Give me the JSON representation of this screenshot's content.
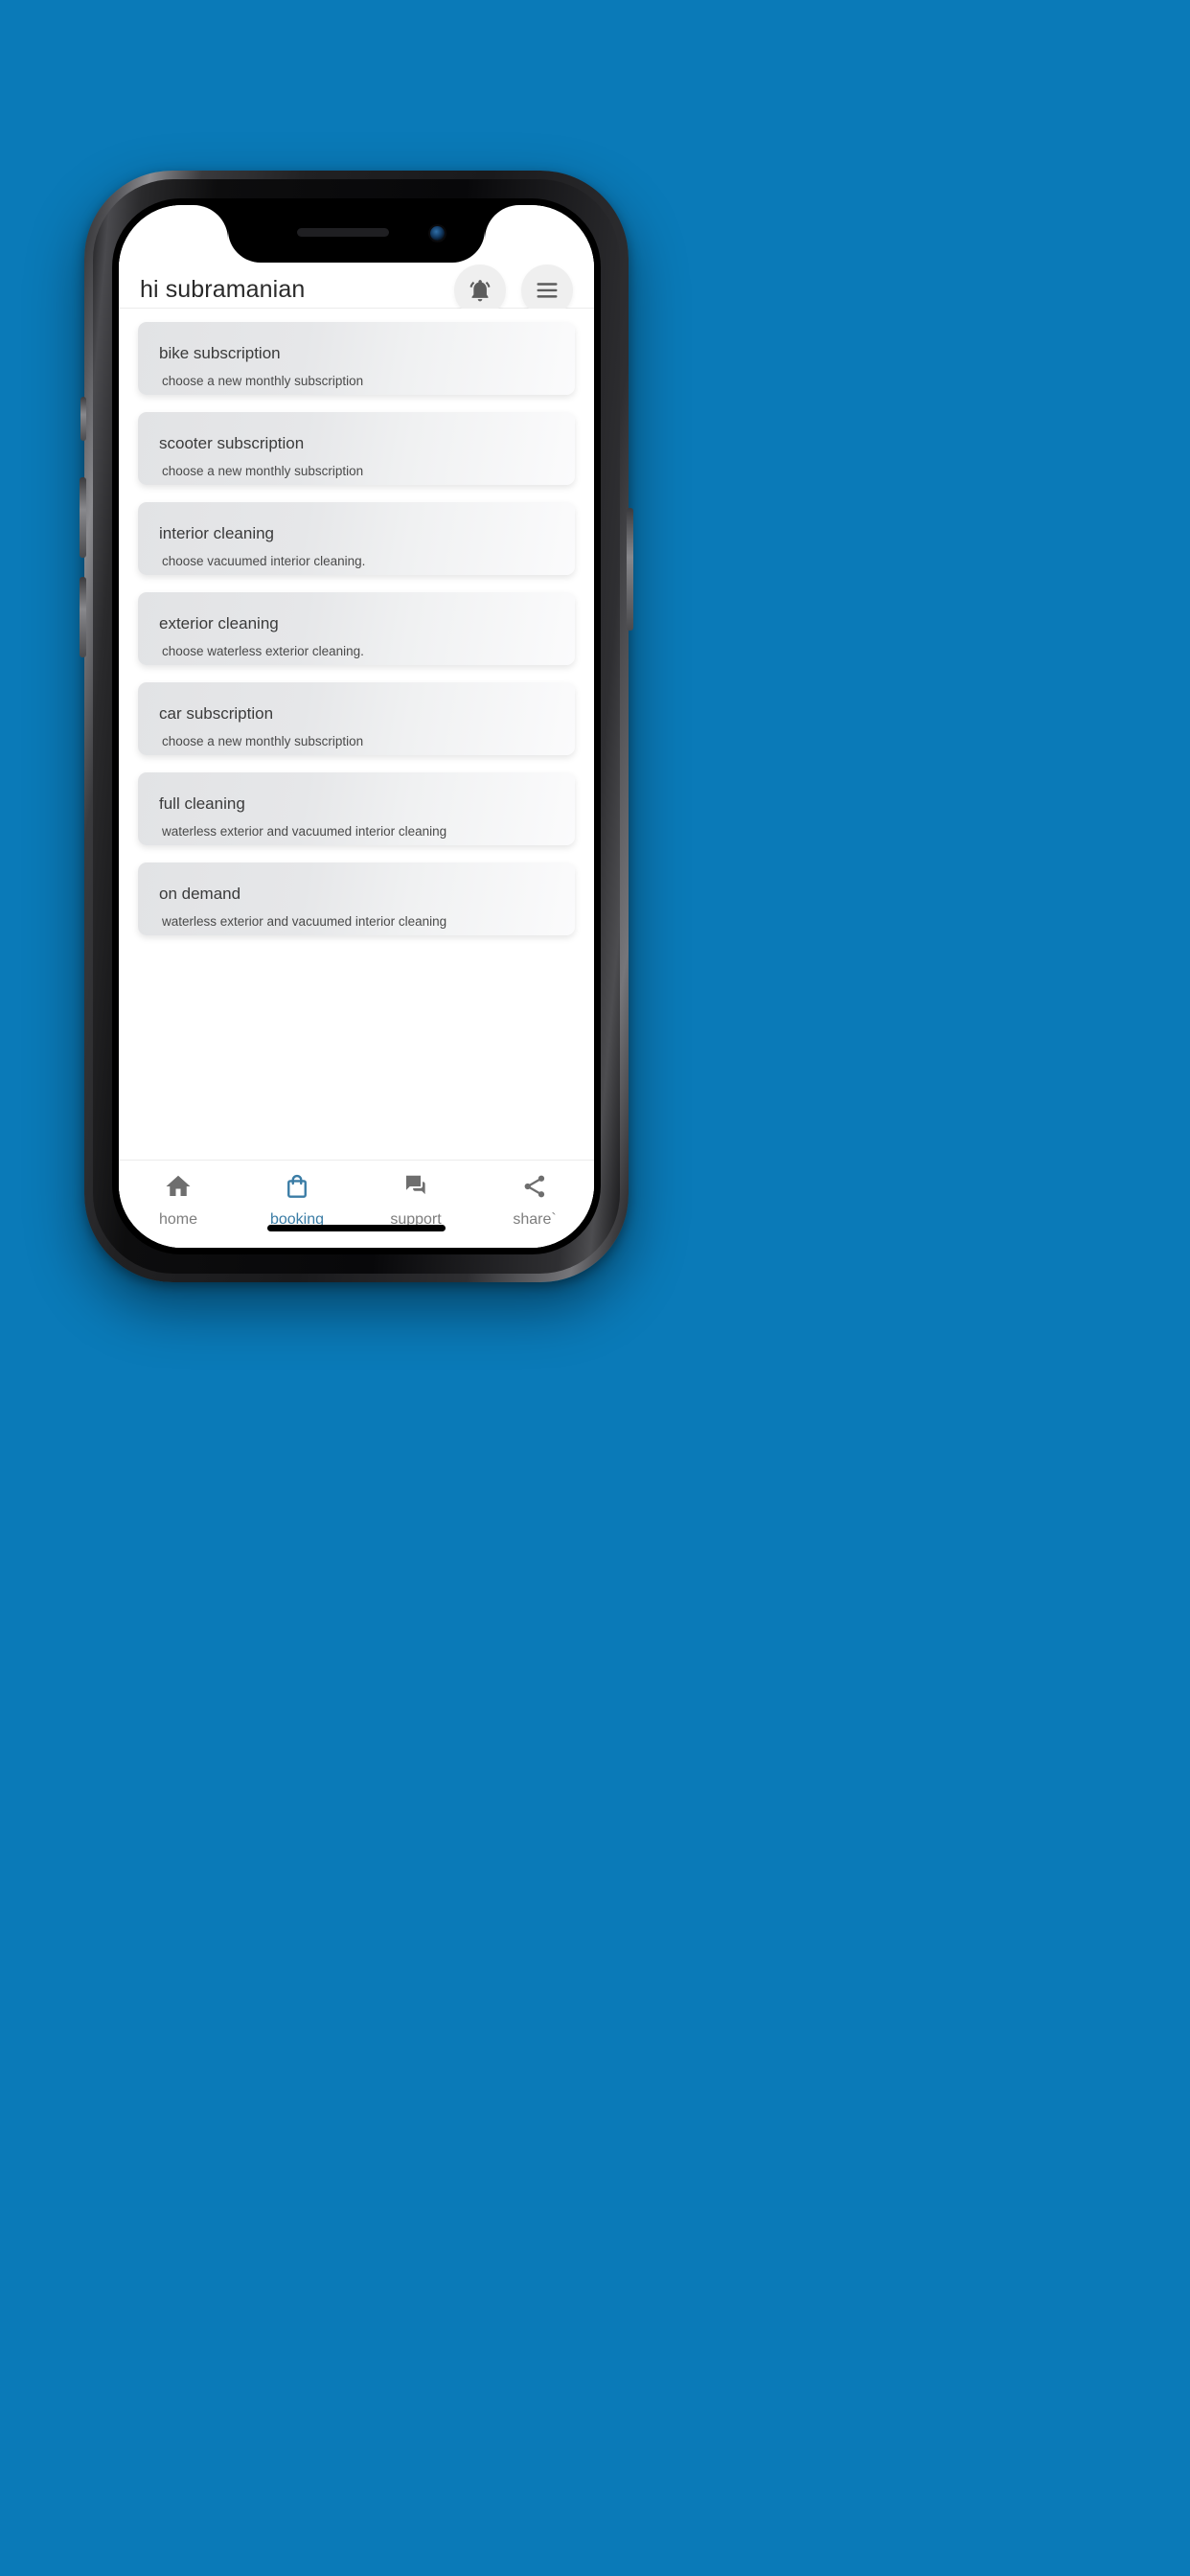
{
  "theme": {
    "page_background": "#0a7ab8",
    "accent": "#3a7ca5",
    "nav_inactive": "#7d7d7d",
    "card_gradient_start": "#e2e3e5",
    "card_gradient_end": "#fbfbfc",
    "screen_background": "#ffffff"
  },
  "header": {
    "greeting": "hi subramanian",
    "notifications_icon": "bell-active-icon",
    "menu_icon": "hamburger-menu-icon"
  },
  "services": [
    {
      "title": "bike subscription",
      "subtitle": "choose a new monthly subscription"
    },
    {
      "title": "scooter subscription",
      "subtitle": "choose a new monthly subscription"
    },
    {
      "title": "interior cleaning",
      "subtitle": "choose vacuumed interior cleaning."
    },
    {
      "title": "exterior cleaning",
      "subtitle": "choose waterless exterior cleaning."
    },
    {
      "title": "car subscription",
      "subtitle": "choose a new monthly subscription"
    },
    {
      "title": "full cleaning",
      "subtitle": "waterless exterior and vacuumed interior cleaning"
    },
    {
      "title": "on demand",
      "subtitle": "waterless exterior and vacuumed interior cleaning"
    }
  ],
  "bottom_nav": {
    "items": [
      {
        "label": "home",
        "icon": "home-icon",
        "active": false
      },
      {
        "label": "booking",
        "icon": "shopping-bag-icon",
        "active": true
      },
      {
        "label": "support",
        "icon": "chat-bubbles-icon",
        "active": false
      },
      {
        "label": "share`",
        "icon": "share-nodes-icon",
        "active": false
      }
    ]
  },
  "device": {
    "notch_speaker": "speaker-grille",
    "notch_camera": "front-camera-lens",
    "home_indicator": "home-indicator-bar"
  }
}
